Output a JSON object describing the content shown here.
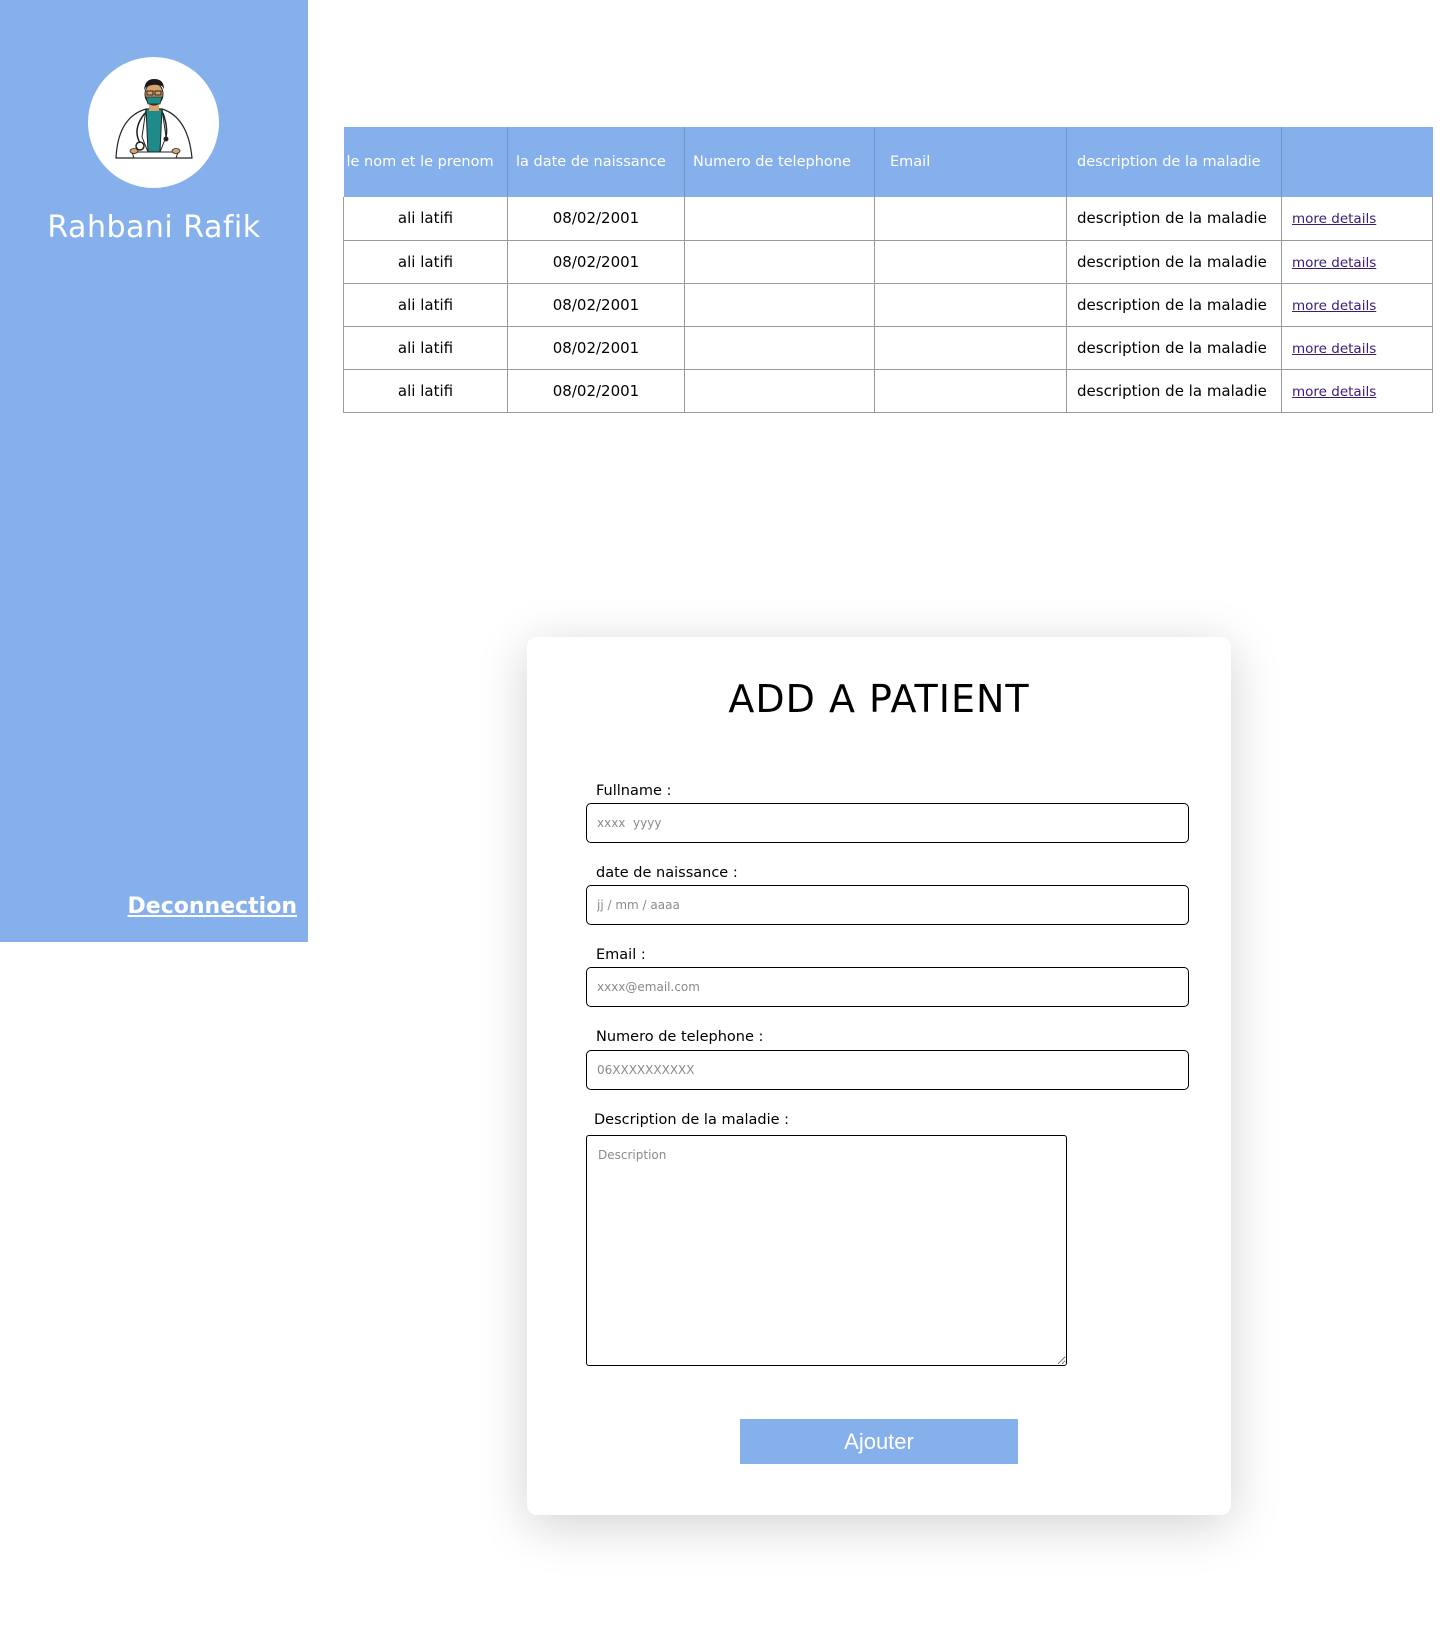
{
  "sidebar": {
    "doctor_name": "Rahbani Rafik",
    "avatar_icon": "doctor-avatar-icon",
    "logout_label": "Deconnection",
    "background": "#85b0ec"
  },
  "table": {
    "headers": [
      "le nom et le prenom",
      "la date de naissance",
      "Numero de telephone",
      "Email",
      "description de la maladie",
      ""
    ],
    "rows": [
      {
        "name": "ali latifi",
        "birth_date": "08/02/2001",
        "phone": "",
        "email": "",
        "description": "description de la maladie",
        "link": "more details"
      },
      {
        "name": "ali latifi",
        "birth_date": "08/02/2001",
        "phone": "",
        "email": "",
        "description": "description de la maladie",
        "link": "more details"
      },
      {
        "name": "ali latifi",
        "birth_date": "08/02/2001",
        "phone": "",
        "email": "",
        "description": "description de la maladie",
        "link": "more details"
      },
      {
        "name": "ali latifi",
        "birth_date": "08/02/2001",
        "phone": "",
        "email": "",
        "description": "description de la maladie",
        "link": "more details"
      },
      {
        "name": "ali latifi",
        "birth_date": "08/02/2001",
        "phone": "",
        "email": "",
        "description": "description de la maladie",
        "link": "more details"
      }
    ]
  },
  "form": {
    "title": "ADD A PATIENT",
    "fullname_label": "Fullname :",
    "fullname_placeholder": "xxxx  yyyy",
    "birth_label": "date de naissance :",
    "birth_placeholder": "jj / mm / aaaa",
    "email_label": "Email :",
    "email_placeholder": "xxxx@email.com",
    "phone_label": "Numero de telephone :",
    "phone_placeholder": "06XXXXXXXXXX",
    "description_label": "Description de la maladie :",
    "description_placeholder": "Description",
    "submit_label": "Ajouter"
  }
}
